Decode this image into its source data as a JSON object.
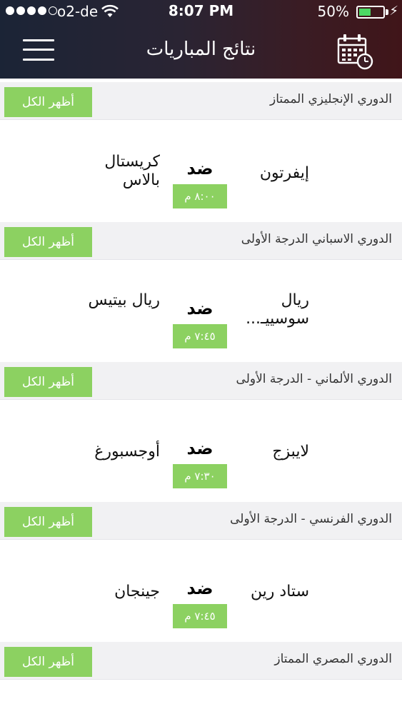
{
  "status_bar": {
    "carrier": "o2-de",
    "time": "8:07 PM",
    "battery": "50%",
    "battery_level": 0.5
  },
  "header": {
    "title": "نتائج المباريات",
    "menu_icon": "hamburger-menu-icon",
    "calendar_icon": "calendar-icon"
  },
  "colors": {
    "accent_green": "#8cd161",
    "league_bar": "#f1f1f3",
    "header_dark": "#1b2436",
    "header_red": "#401519"
  },
  "sections": [
    {
      "league": "الدوري الإنجليزي الممتاز",
      "show_all": "أظهر الكل",
      "match": {
        "home": "إيفرتون",
        "away": "كريستال بالاس",
        "vs": "ضد",
        "time": "٨:٠٠ م"
      }
    },
    {
      "league": "الدوري الاسباني الدرجة الأولى",
      "show_all": "أظهر الكل",
      "match": {
        "home": "ريال سوسييـ...",
        "away": "ريال بيتيس",
        "vs": "ضد",
        "time": "٧:٤٥ م"
      }
    },
    {
      "league": "الدوري الألماني - الدرجة الأولى",
      "show_all": "أظهر الكل",
      "match": {
        "home": "لايبزج",
        "away": "أوجسبورغ",
        "vs": "ضد",
        "time": "٧:٣٠ م"
      }
    },
    {
      "league": "الدوري الفرنسي - الدرجة الأولى",
      "show_all": "أظهر الكل",
      "match": {
        "home": "ستاد رين",
        "away": "جينجان",
        "vs": "ضد",
        "time": "٧:٤٥ م"
      }
    },
    {
      "league": "الدوري المصري الممتاز",
      "show_all": "أظهر الكل"
    }
  ]
}
